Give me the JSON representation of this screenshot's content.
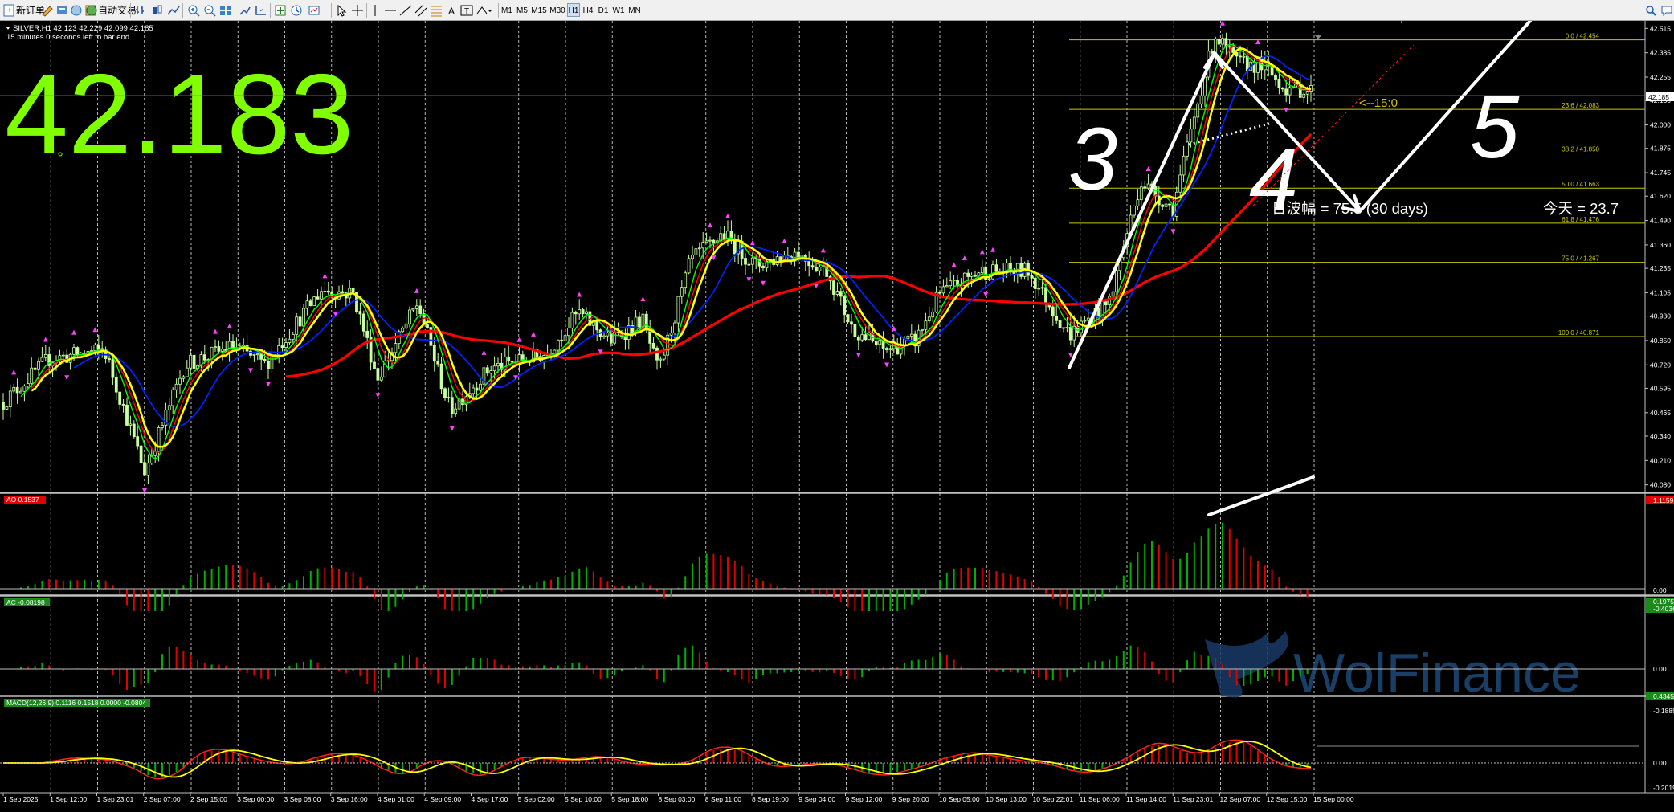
{
  "toolbar": {
    "new_order_label": "新订单",
    "auto_trading_label": "自动交易",
    "timeframes": [
      "M1",
      "M5",
      "M15",
      "M30",
      "H1",
      "H4",
      "D1",
      "W1",
      "MN"
    ]
  },
  "chart": {
    "symbol_header": "SILVER,H1  42.123 42.229 42.099 42.185",
    "countdown": "15 minutes 0 seconds left to bar end",
    "big_price": "42.183",
    "price_tag": "42.185",
    "wave_text": "日波幅 = 75.5   (30 days)",
    "today_text": "今天 = 23.7",
    "pointer_label": "<--15:0",
    "wave_labels": [
      "3",
      "4",
      "5"
    ],
    "watermark": "WolFinance"
  },
  "colors": {
    "candle": "#c8ffa0",
    "ma_red": "#ff0000",
    "ma_yellow": "#ffff00",
    "ma_green": "#00ff00",
    "ma_blue": "#0022ff",
    "fib": "#c8c800",
    "big_price": "#7fff00"
  },
  "price_axis": [
    "42.515",
    "42.385",
    "42.255",
    "42.130",
    "42.000",
    "41.875",
    "41.745",
    "41.620",
    "41.490",
    "41.360",
    "41.235",
    "41.105",
    "40.980",
    "40.850",
    "40.720",
    "40.595",
    "40.465",
    "40.340",
    "40.210",
    "40.080"
  ],
  "fib_levels": [
    {
      "label": "0.0 / 42.454",
      "price": 42.454
    },
    {
      "label": "23.6 / 42.083",
      "price": 42.083
    },
    {
      "label": "38.2 / 41.850",
      "price": 41.85
    },
    {
      "label": "50.0 / 41.663",
      "price": 41.663
    },
    {
      "label": "61.8 / 41.476",
      "price": 41.476
    },
    {
      "label": "75.0 / 41.267",
      "price": 41.267
    },
    {
      "label": "100.0 / 40.871",
      "price": 40.871
    }
  ],
  "indicators": {
    "ao": {
      "label": "AO 0.1537",
      "axis": [
        "1.1159",
        "0.00",
        "-0.4036"
      ]
    },
    "ac": {
      "label": "AC -0.08198",
      "axis": [
        "0.1975",
        "0.00",
        "-0.1885"
      ]
    },
    "macd": {
      "label": "MACD(12,26,9) 0.1116 0.1518 0.0000 -0.0804",
      "axis": [
        "0.4345",
        "0.00",
        "-0.2019"
      ]
    }
  },
  "time_axis": [
    "1 Sep 2025",
    "1 Sep 12:00",
    "1 Sep 23:01",
    "2 Sep 07:00",
    "2 Sep 15:00",
    "3 Sep 00:00",
    "3 Sep 08:00",
    "3 Sep 16:00",
    "4 Sep 01:00",
    "4 Sep 09:00",
    "4 Sep 17:00",
    "5 Sep 02:00",
    "5 Sep 10:00",
    "5 Sep 18:00",
    "8 Sep 03:00",
    "8 Sep 11:00",
    "8 Sep 19:00",
    "9 Sep 04:00",
    "9 Sep 12:00",
    "9 Sep 20:00",
    "10 Sep 05:00",
    "10 Sep 13:00",
    "10 Sep 22:01",
    "11 Sep 06:00",
    "11 Sep 14:00",
    "11 Sep 23:01",
    "12 Sep 07:00",
    "12 Sep 15:00",
    "15 Sep 00:00"
  ]
}
